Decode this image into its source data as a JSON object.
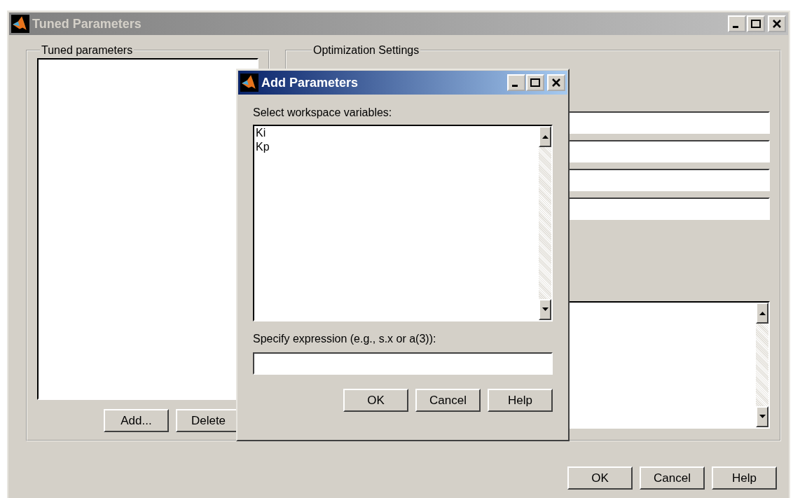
{
  "window": {
    "title": "Tuned Parameters",
    "active": false
  },
  "tuned_group": {
    "title": "Tuned parameters",
    "buttons": [
      "Add...",
      "Delete"
    ]
  },
  "settings_group": {
    "title": "Optimization Settings"
  },
  "buttons": [
    "OK",
    "Cancel",
    "Help"
  ],
  "dialog": {
    "title": "Add Parameters",
    "active": true,
    "list_label": "Select workspace variables:",
    "variables": [
      {
        "name": "Ki",
        "selected": false
      },
      {
        "name": "Kp",
        "selected": false
      }
    ],
    "expression_label": "Specify expression (e.g., s.x or a(3)):",
    "buttons": [
      "OK",
      "Cancel",
      "Help"
    ]
  }
}
